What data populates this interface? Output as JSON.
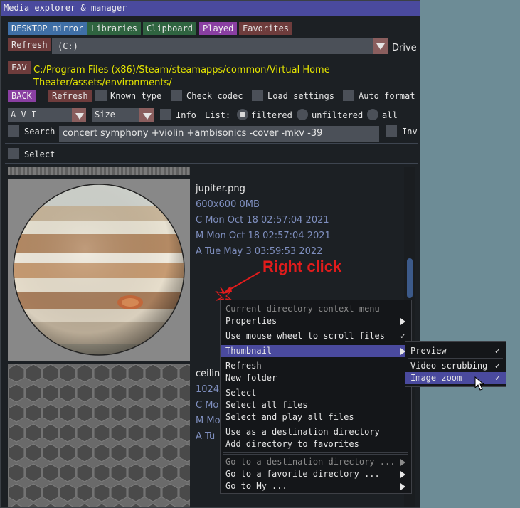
{
  "window": {
    "title": "Media explorer & manager"
  },
  "toolbar": {
    "desktop_mirror": "DESKTOP mirror",
    "libraries": "Libraries",
    "clipboard": "Clipboard",
    "played": "Played",
    "favorites": "Favorites"
  },
  "drive": {
    "refresh": "Refresh",
    "selected": "(C:)",
    "label": "Drive"
  },
  "path": {
    "fav": "FAV",
    "line1": "C:/Program Files (x86)/Steam/steamapps/common/Virtual Home",
    "line2": "Theater/assets/environments/"
  },
  "options": {
    "back": "BACK",
    "refresh": "Refresh",
    "known_type": "Known type",
    "check_codec": "Check codec",
    "load_settings": "Load settings",
    "auto_format": "Auto format"
  },
  "filter": {
    "type_selected": "A V I",
    "sort_selected": "Size",
    "info": "Info",
    "list_label": "List:",
    "filtered": "filtered",
    "unfiltered": "unfiltered",
    "all": "all"
  },
  "search": {
    "label": "Search",
    "value": "concert symphony +violin +ambisonics -cover -mkv -39",
    "inv": "Inv"
  },
  "select": {
    "label": "Select"
  },
  "files": [
    {
      "name": "jupiter.png",
      "size": "600x600  0MB",
      "created": "C Mon Oct 18 02:57:04 2021",
      "modified": "M Mon Oct 18 02:57:04 2021",
      "accessed": "A Tue May  3 03:59:53 2022"
    },
    {
      "name": "ceiling",
      "size": "1024x",
      "created": "C Mo",
      "modified": "M Mo",
      "accessed": "A Tu"
    }
  ],
  "annotation": {
    "right_click": "Right click"
  },
  "context_menu": {
    "header": "Current directory context menu",
    "properties": "Properties",
    "mouse_wheel": "Use mouse wheel to scroll files",
    "thumbnail": "Thumbnail",
    "refresh": "Refresh",
    "new_folder": "New folder",
    "select": "Select",
    "select_all": "Select all files",
    "select_play_all": "Select and play all files",
    "use_destination": "Use as a destination directory",
    "add_favorites": "Add directory to favorites",
    "goto_destination": "Go to a destination directory ...",
    "goto_favorite": "Go to a favorite directory ...",
    "goto_my": "Go to My ..."
  },
  "submenu": {
    "preview": "Preview",
    "video_scrubbing": "Video scrubbing",
    "image_zoom": "Image zoom"
  },
  "colors": {
    "accent": "#4a4a9e",
    "path_text": "#e6e600",
    "meta_text": "#7f8fbf",
    "annotation": "#e21c1c"
  }
}
